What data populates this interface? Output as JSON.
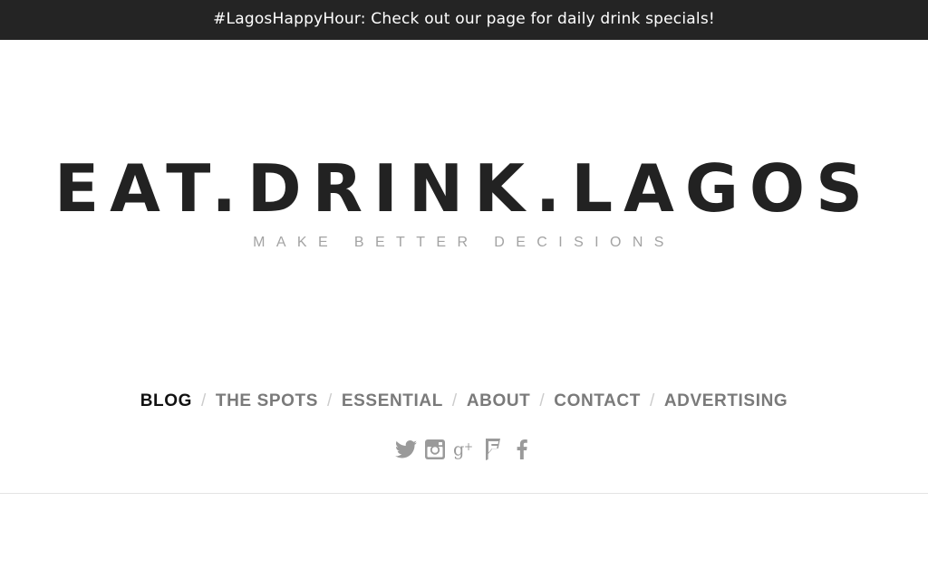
{
  "announcement": {
    "text": "#LagosHappyHour: Check out our page for daily drink specials!"
  },
  "header": {
    "title": "EAT.DRINK.LAGOS",
    "tagline": "MAKE BETTER DECISIONS"
  },
  "nav": {
    "items": [
      {
        "label": "BLOG",
        "active": true
      },
      {
        "label": "THE SPOTS"
      },
      {
        "label": "ESSENTIAL"
      },
      {
        "label": "ABOUT"
      },
      {
        "label": "CONTACT"
      },
      {
        "label": "ADVERTISING"
      }
    ],
    "separator": "/"
  },
  "social": {
    "icons": [
      "twitter-icon",
      "instagram-icon",
      "google-plus-icon",
      "foursquare-icon",
      "facebook-icon"
    ],
    "icon_color": "#9a9a9a"
  },
  "colors": {
    "announcement_bg": "#242424",
    "title": "#222222",
    "tagline": "#a3a3a3",
    "nav_active": "#111111",
    "nav_inactive": "#7a7a7a"
  }
}
